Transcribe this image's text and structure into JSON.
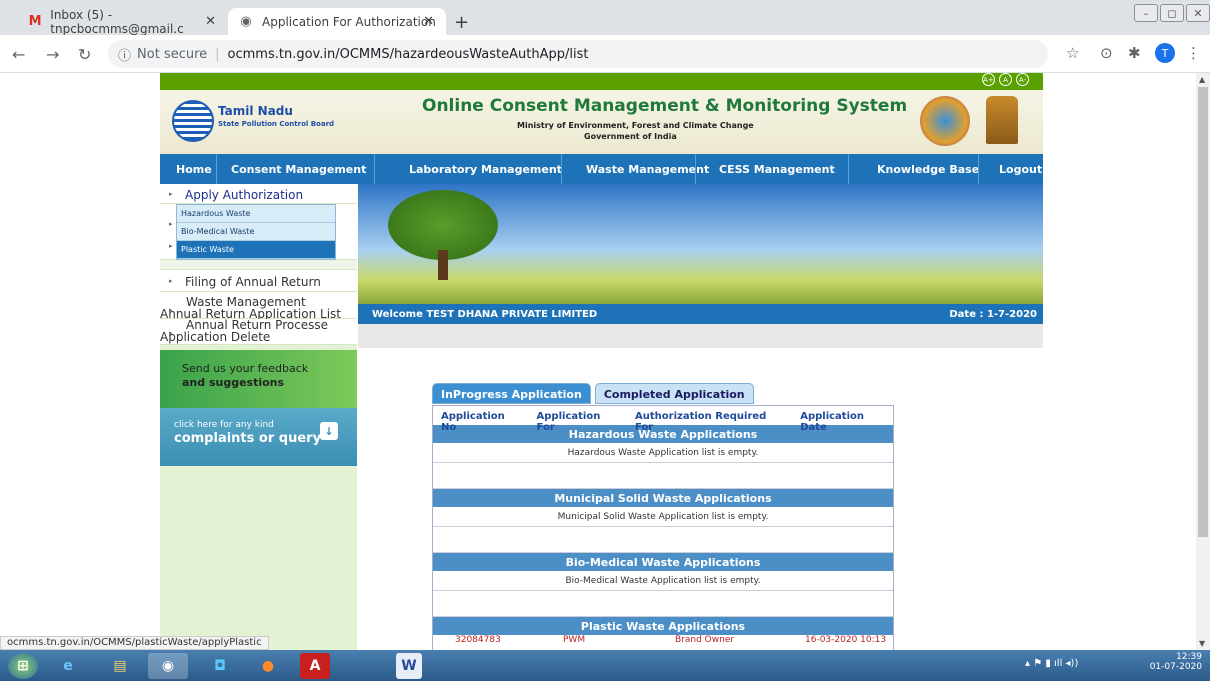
{
  "browser": {
    "tabs": [
      {
        "title": "Inbox (5) - tnpcbocmms@gmail.c",
        "icon": "gmail-icon"
      },
      {
        "title": "Application For Authorization",
        "icon": "globe-icon"
      }
    ],
    "url_security": "Not secure",
    "url": "ocmms.tn.gov.in/OCMMS/hazardeousWasteAuthApp/list",
    "avatar_letter": "T",
    "status_url": "ocmms.tn.gov.in/OCMMS/plasticWaste/applyPlastic"
  },
  "header": {
    "board_name": "Tamil Nadu",
    "board_sub": "State Pollution Control Board",
    "title": "Online Consent Management & Monitoring System",
    "ministry": "Ministry of Environment, Forest and Climate Change",
    "government": "Government of India",
    "font_controls": [
      "A+",
      "A",
      "A-"
    ]
  },
  "menu": {
    "items": [
      "Home",
      "Consent Management",
      "Laboratory Management",
      "Waste Management",
      "CESS Management",
      "Knowledge Base",
      "Logout"
    ]
  },
  "sidebar": {
    "items": [
      "Apply Authorization",
      "Filing of Annual Return",
      "Waste Management Annual Return Application List",
      "Annual Return Processe Application Delete"
    ],
    "submenu": [
      "Hazardous Waste",
      "Bio-Medical Waste",
      "Plastic Waste"
    ],
    "feedback_line1": "Send us your feedback",
    "feedback_line2": "and suggestions",
    "complaints_line1": "click here for any kind",
    "complaints_line2": "complaints or query"
  },
  "welcome": {
    "text": "Welcome TEST DHANA PRIVATE LIMITED",
    "date": "Date : 1-7-2020"
  },
  "applications": {
    "tabs": [
      "InProgress Application",
      "Completed Application"
    ],
    "columns": [
      "Application No",
      "Application For",
      "Authorization Required For",
      "Application Date"
    ],
    "sections": [
      {
        "title": "Hazardous Waste Applications",
        "message": "Hazardous Waste Application list is empty."
      },
      {
        "title": "Municipal Solid Waste Applications",
        "message": "Municipal Solid Waste Application list is empty."
      },
      {
        "title": "Bio-Medical Waste Applications",
        "message": "Bio-Medical Waste Application list is empty."
      },
      {
        "title": "Plastic Waste Applications",
        "message": ""
      }
    ],
    "plastic_row": [
      "32084783",
      "PWM",
      "Brand Owner",
      "16-03-2020 10:13"
    ]
  },
  "taskbar": {
    "time": "12:39",
    "date": "01-07-2020"
  }
}
